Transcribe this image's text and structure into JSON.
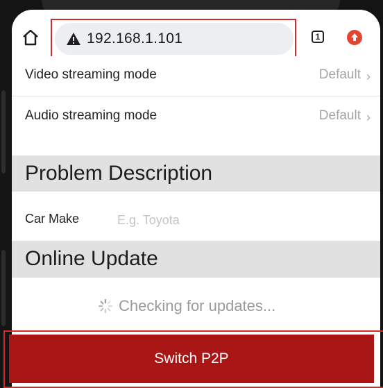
{
  "browser": {
    "url": "192.168.1.101",
    "tab_count": "1"
  },
  "settings": {
    "video": {
      "label": "Video streaming mode",
      "value": "Default"
    },
    "audio": {
      "label": "Audio streaming mode",
      "value": "Default"
    }
  },
  "problem_section": {
    "title": "Problem Description",
    "car_make_label": "Car Make",
    "car_make_placeholder": "E.g. Toyota",
    "car_make_value": ""
  },
  "update_section": {
    "title": "Online Update",
    "status": "Checking for updates..."
  },
  "switch_button_label": "Switch P2P",
  "colors": {
    "accent_red": "#a91616",
    "highlight_red": "#cf2b2b",
    "section_bg": "#e1e1e1",
    "url_bar_bg": "#eceef1"
  }
}
